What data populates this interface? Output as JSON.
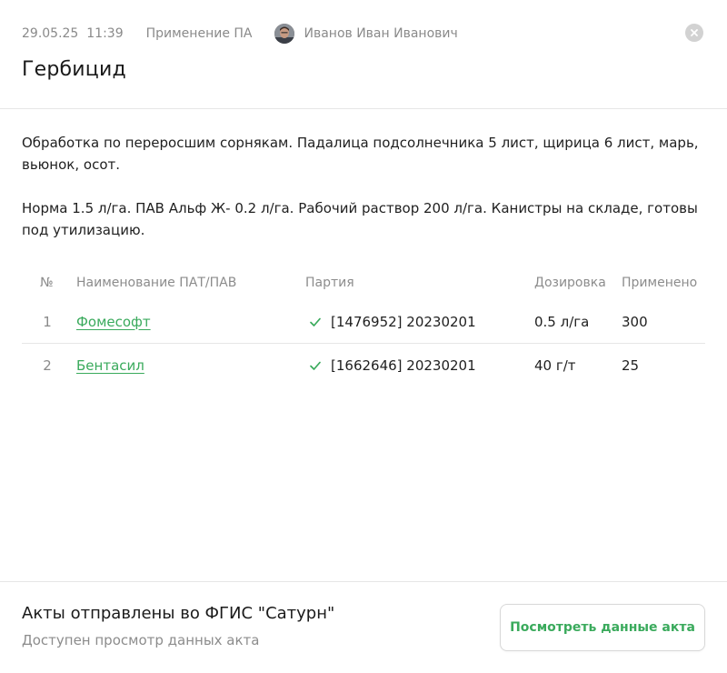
{
  "header": {
    "date": "29.05.25",
    "time": "11:39",
    "type": "Применение ПА",
    "author": "Иванов Иван Иванович",
    "close_icon": "close-icon",
    "title": "Гербицид"
  },
  "description": {
    "paragraph1": "Обработка по переросшим сорнякам. Падалица подсолнечника 5 лист, щирица 6 лист, марь, вьюнок, осот.",
    "paragraph2": "Норма 1.5 л/га. ПАВ Альф Ж- 0.2 л/га. Рабочий раствор 200 л/га. Канистры на складе, готовы под утилизацию."
  },
  "table": {
    "headers": [
      "№",
      "Наименование ПАТ/ПАВ",
      "Партия",
      "Дозировка",
      "Применено"
    ],
    "rows": [
      {
        "num": "1",
        "name": "Фомесофт",
        "batch": "[1476952] 20230201",
        "dose": "0.5 л/га",
        "applied": "300"
      },
      {
        "num": "2",
        "name": "Бентасил",
        "batch": "[1662646] 20230201",
        "dose": "40 г/т",
        "applied": "25"
      }
    ]
  },
  "footer": {
    "title": "Акты отправлены во ФГИС \"Сатурн\"",
    "subtitle": "Доступен просмотр данных акта",
    "button_label": "Посмотреть данные акта"
  },
  "colors": {
    "accent": "#3aaa5c",
    "muted_text": "#8c8c8c",
    "divider": "#e6e6e6"
  }
}
